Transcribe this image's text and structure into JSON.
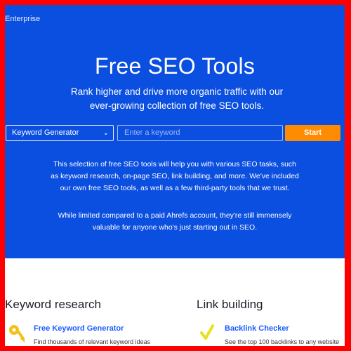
{
  "header": {
    "enterprise": "Enterprise"
  },
  "hero": {
    "title": "Free SEO Tools",
    "subtitle": "Rank higher and drive more organic traffic with our ever-growing collection of free SEO tools.",
    "select_value": "Keyword Generator",
    "input_placeholder": "Enter a keyword",
    "start_label": "Start",
    "paragraph1": "This selection of free SEO tools will help you with various SEO tasks, such as keyword research, on-page SEO, link building, and more. We've included our own free SEO tools, as well as a few third-party tools that we trust.",
    "paragraph2": "While limited compared to a paid Ahrefs account, they're still immensely valuable for anyone who's just starting out in SEO."
  },
  "sections": [
    {
      "title": "Keyword research",
      "tool": {
        "name": "Free Keyword Generator",
        "description": "Find thousands of relevant keyword ideas",
        "icon": "key-icon"
      }
    },
    {
      "title": "Link building",
      "tool": {
        "name": "Backlink Checker",
        "description": "See the top 100 backlinks to any website",
        "icon": "checkmark-icon"
      }
    }
  ],
  "colors": {
    "hero_bg": "#0b4fe0",
    "accent": "#ff8c00",
    "link": "#1a5cff",
    "icon_yellow": "#f2c21b"
  }
}
